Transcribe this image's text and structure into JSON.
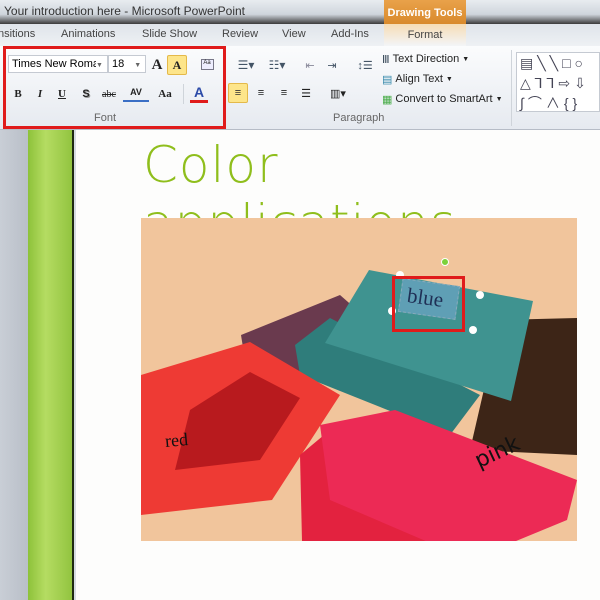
{
  "window": {
    "title": "Your introduction here  -  Microsoft PowerPoint",
    "contextual_tab": "Drawing Tools"
  },
  "tabs": [
    {
      "label": "nsitions"
    },
    {
      "label": "Animations"
    },
    {
      "label": "Slide Show"
    },
    {
      "label": "Review"
    },
    {
      "label": "View"
    },
    {
      "label": "Add-Ins"
    },
    {
      "label": "Format"
    }
  ],
  "font_group": {
    "font_name": "Times New Roman",
    "font_size": "18",
    "bold": "B",
    "italic": "I",
    "underline": "U",
    "shadow": "S",
    "strike": "abc",
    "spacing": "AV",
    "change_case": "Aa",
    "font_color": "A",
    "grow": "A",
    "shrink": "A",
    "label": "Font",
    "font_color_hex": "#e01b1b"
  },
  "paragraph_group": {
    "text_direction": "Text Direction",
    "align_text": "Align Text",
    "convert_smartart": "Convert to SmartArt",
    "label": "Paragraph"
  },
  "slide": {
    "title": "Color applications",
    "labels": {
      "red": "red",
      "blue": "blue",
      "pink": "pink"
    }
  },
  "colors": {
    "title": "#8fbe1c",
    "highlight": "#e01b1b",
    "teal": "#3f8f8c",
    "red": "#ee3a34",
    "pink": "#ec2a55"
  }
}
